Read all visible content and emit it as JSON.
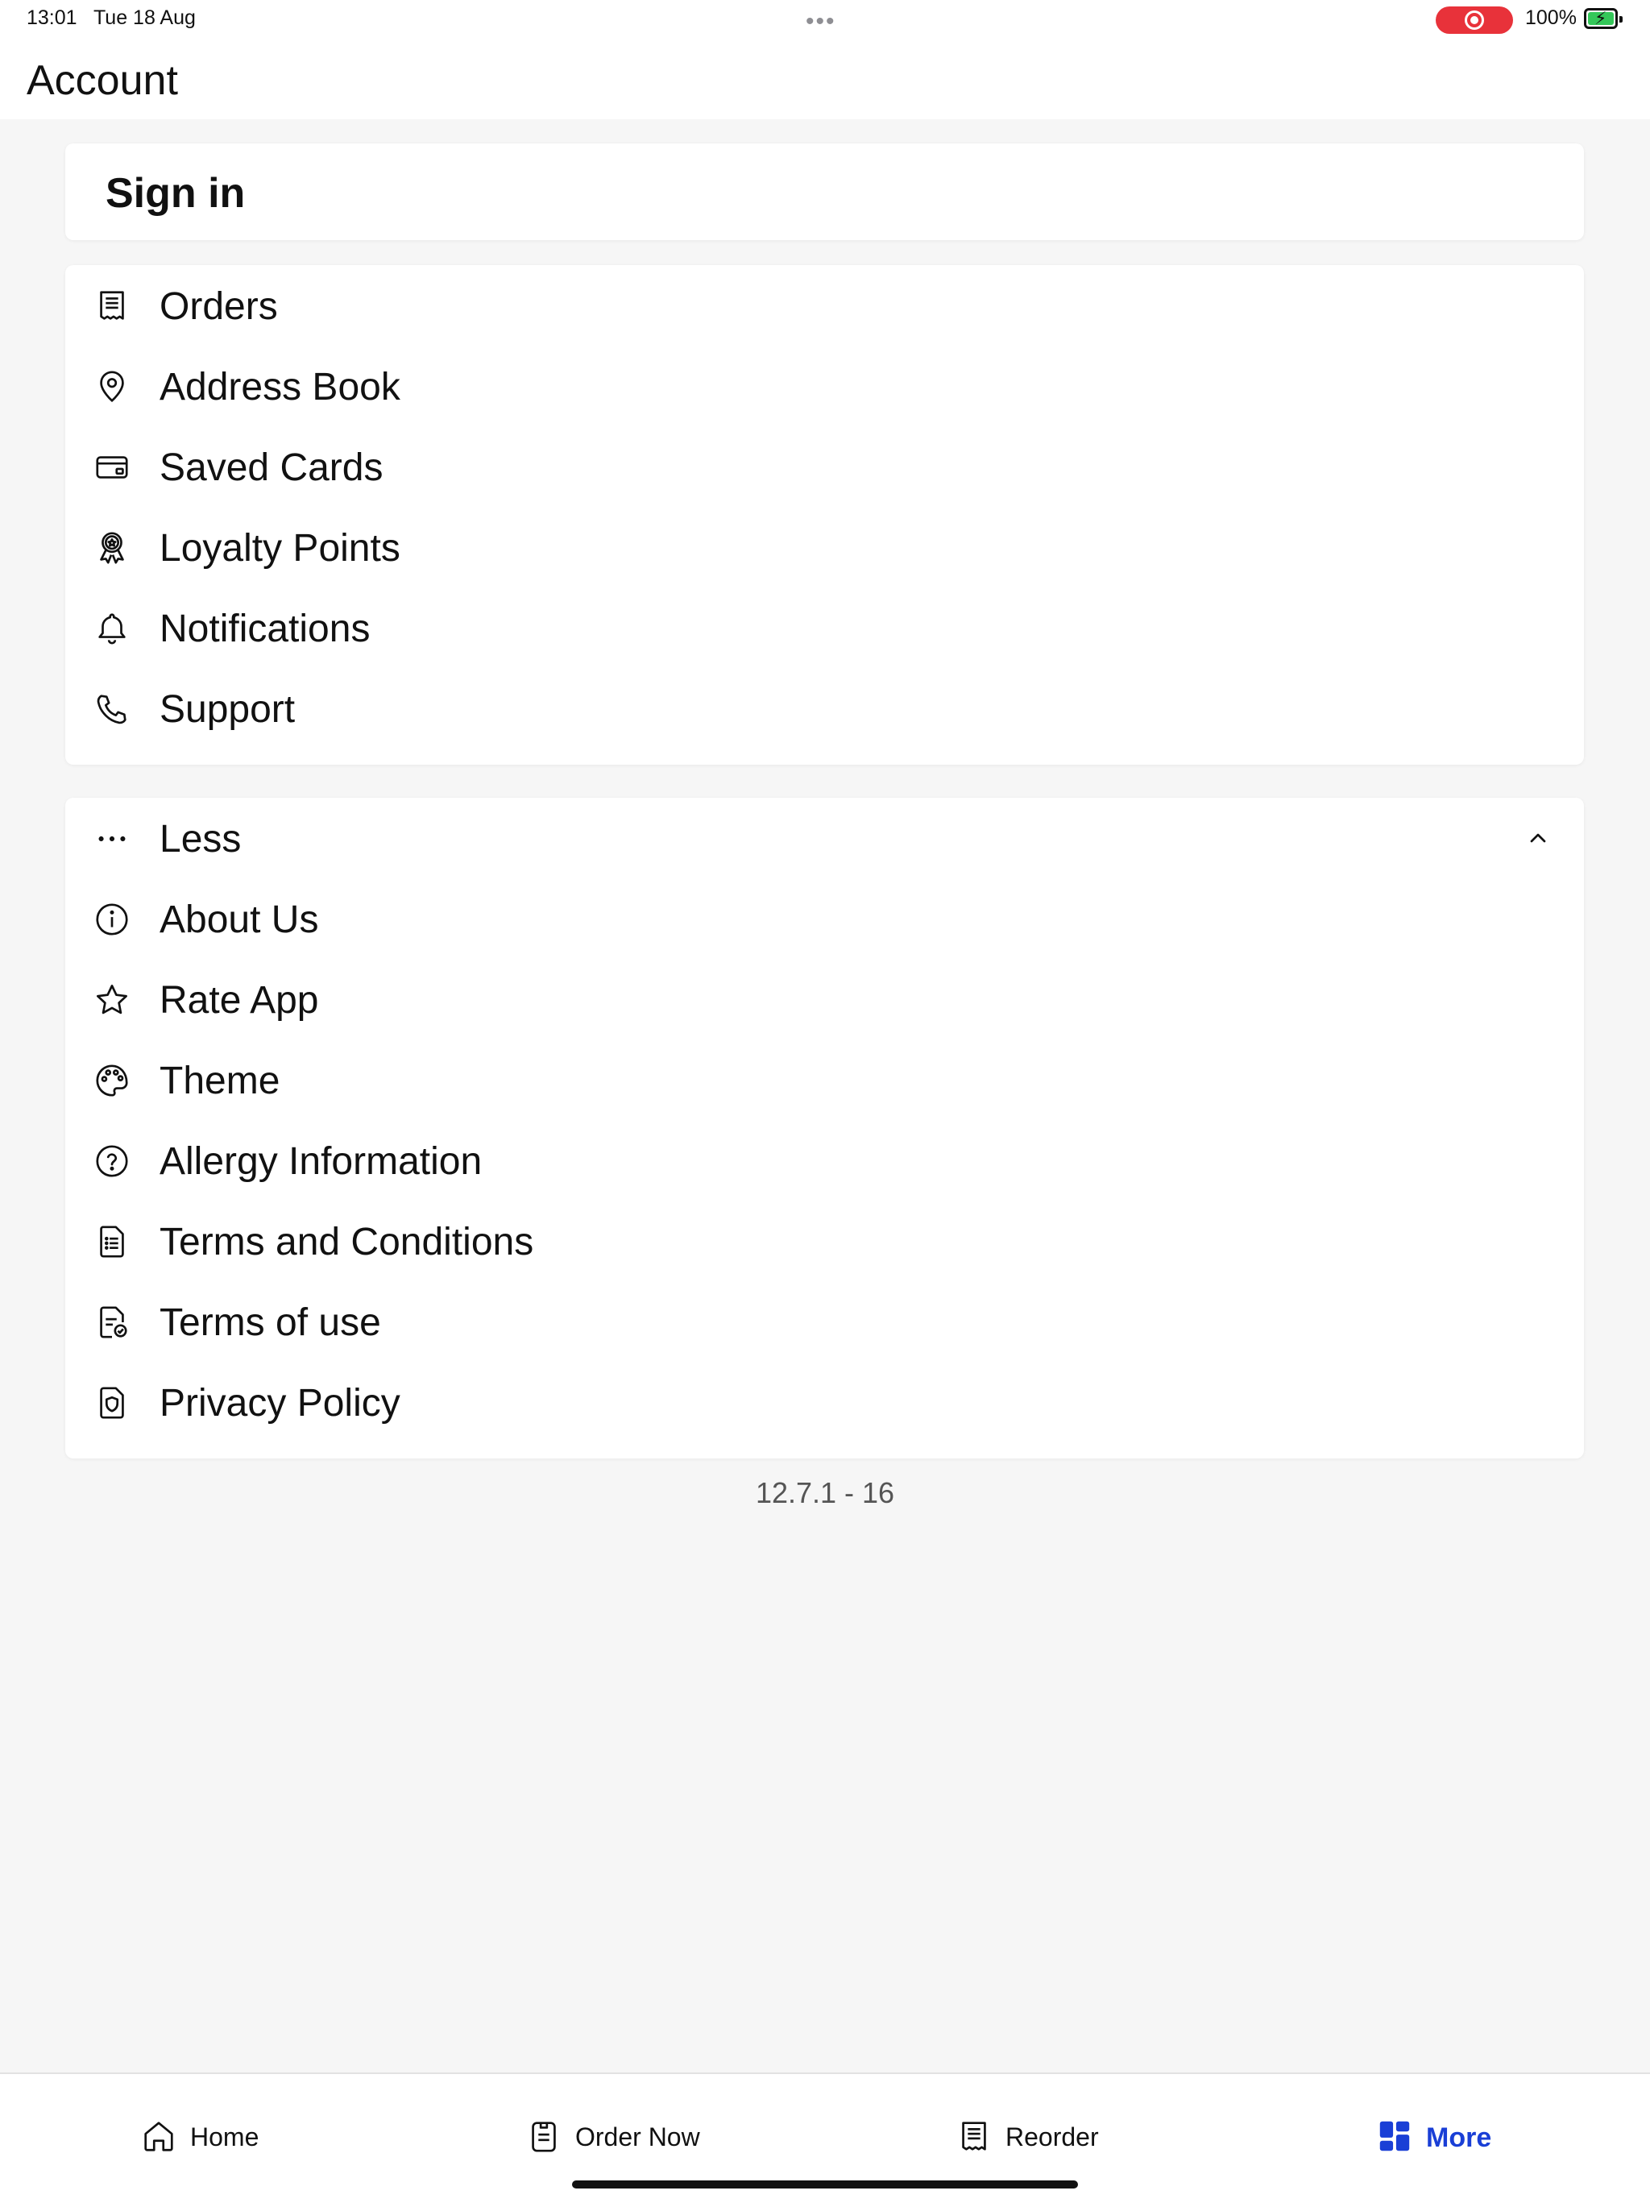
{
  "status_bar": {
    "time": "13:01",
    "date": "Tue 18 Aug",
    "dots": "•••",
    "battery_percent": "100%",
    "battery_level": 1.0,
    "record_color": "#e8323a",
    "battery_color": "#34c759"
  },
  "header": {
    "title": "Account"
  },
  "sign_in": {
    "label": "Sign in"
  },
  "menu_primary": [
    {
      "label": "Orders",
      "icon": "receipt-icon"
    },
    {
      "label": "Address Book",
      "icon": "location-pin-icon"
    },
    {
      "label": "Saved Cards",
      "icon": "credit-card-icon"
    },
    {
      "label": "Loyalty Points",
      "icon": "award-ribbon-icon"
    },
    {
      "label": "Notifications",
      "icon": "bell-icon"
    },
    {
      "label": "Support",
      "icon": "phone-icon"
    }
  ],
  "menu_secondary": {
    "toggle_label": "Less",
    "toggle_icon": "more-dots-icon",
    "expanded": true,
    "items": [
      {
        "label": "About Us",
        "icon": "info-icon"
      },
      {
        "label": "Rate App",
        "icon": "star-icon"
      },
      {
        "label": "Theme",
        "icon": "palette-icon"
      },
      {
        "label": "Allergy Information",
        "icon": "question-icon"
      },
      {
        "label": "Terms and Conditions",
        "icon": "document-list-icon"
      },
      {
        "label": "Terms of use",
        "icon": "document-check-icon"
      },
      {
        "label": "Privacy Policy",
        "icon": "shield-document-icon"
      }
    ]
  },
  "version": "12.7.1 - 16",
  "tab_bar": {
    "accent_color": "#1a3fd6",
    "tabs": [
      {
        "label": "Home",
        "icon": "home-icon",
        "active": false
      },
      {
        "label": "Order Now",
        "icon": "order-icon",
        "active": false
      },
      {
        "label": "Reorder",
        "icon": "reorder-receipt-icon",
        "active": false
      },
      {
        "label": "More",
        "icon": "grid-more-icon",
        "active": true
      }
    ]
  }
}
